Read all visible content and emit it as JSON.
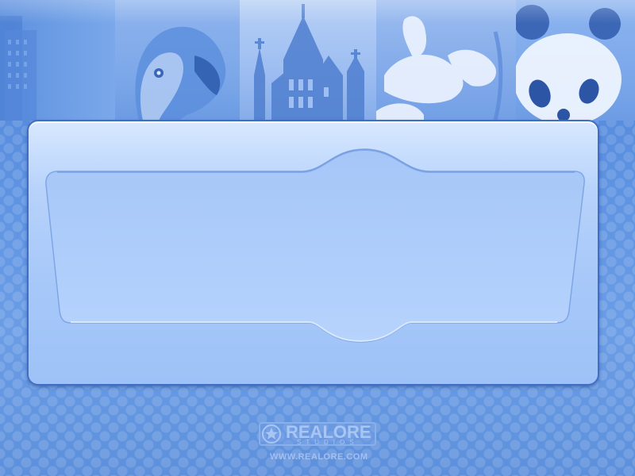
{
  "branding": {
    "logo_word": "REALORE",
    "logo_subtitle": "STUDIOS",
    "website": "WWW.REALORE.COM"
  },
  "photo_strip": {
    "panels": [
      "city-buildings",
      "parrot",
      "castle-towers",
      "white-flowers",
      "panda"
    ]
  },
  "colors": {
    "background": "#5f8fd9",
    "frame_fill": "#a7c8f9",
    "frame_border": "#3f6fc4",
    "inner_panel": "#a6c9fb"
  }
}
